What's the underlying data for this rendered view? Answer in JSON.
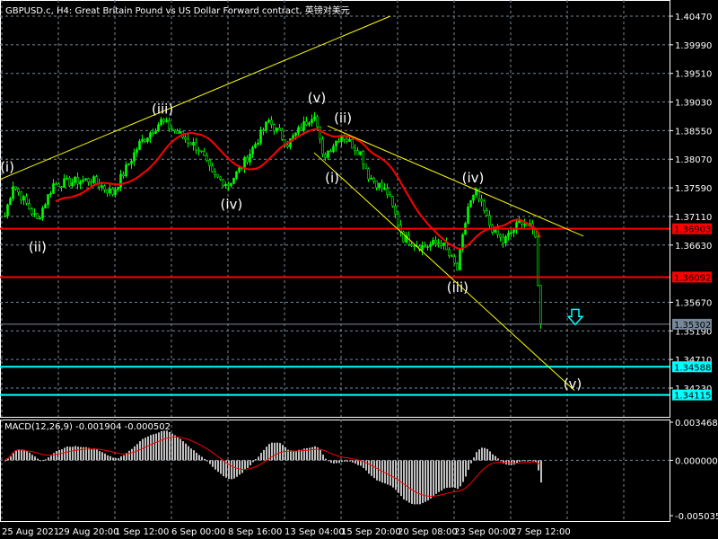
{
  "header": {
    "title": "GBPUSD.c, H4:  Great Britain Pound vs US Dollar Forward contract, 英镑对美元"
  },
  "macd": {
    "title": "MACD(12,26,9) -0.001904 -0.000502"
  },
  "colors": {
    "background": "#000000",
    "candle": "#00ff00",
    "grid": "#778899",
    "ma": "#ff0000",
    "trendline": "#ffff00",
    "support": "#00ffff",
    "resistance": "#ff0000",
    "current": "#778899",
    "macd_hist": "#c0c0c0",
    "macd_signal": "#ff0000"
  },
  "chart_data": {
    "type": "candlestick",
    "symbol": "GBPUSD.c",
    "timeframe": "H4",
    "ylim": [
      1.3395,
      1.4074
    ],
    "price_ticks": [
      "1.40470",
      "1.39990",
      "1.39510",
      "1.39030",
      "1.38550",
      "1.38070",
      "1.37590",
      "1.37110",
      "1.36630",
      "1.35670",
      "1.35190",
      "1.34710",
      "1.34230"
    ],
    "time_ticks": [
      "25 Aug 2021",
      "29 Aug 20:00",
      "1 Sep 12:00",
      "6 Sep 00:00",
      "8 Sep 16:00",
      "13 Sep 04:00",
      "15 Sep 20:00",
      "20 Sep 08:00",
      "23 Sep 00:00",
      "27 Sep 12:00"
    ],
    "bars_per_time_tick": 21,
    "close_waypoints": [
      [
        0,
        1.3712
      ],
      [
        3,
        1.3765
      ],
      [
        12,
        1.3705
      ],
      [
        18,
        1.3765
      ],
      [
        32,
        1.3773
      ],
      [
        40,
        1.375
      ],
      [
        50,
        1.3833
      ],
      [
        58,
        1.3871
      ],
      [
        72,
        1.3825
      ],
      [
        77,
        1.378
      ],
      [
        83,
        1.3765
      ],
      [
        88,
        1.3795
      ],
      [
        98,
        1.3871
      ],
      [
        105,
        1.3833
      ],
      [
        115,
        1.3886
      ],
      [
        118,
        1.381
      ],
      [
        125,
        1.3849
      ],
      [
        132,
        1.3818
      ],
      [
        135,
        1.378
      ],
      [
        142,
        1.375
      ],
      [
        148,
        1.3675
      ],
      [
        155,
        1.366
      ],
      [
        162,
        1.3668
      ],
      [
        168,
        1.3622
      ],
      [
        172,
        1.3727
      ],
      [
        175,
        1.375
      ],
      [
        180,
        1.3697
      ],
      [
        185,
        1.3668
      ],
      [
        192,
        1.3705
      ],
      [
        197,
        1.3682
      ],
      [
        198,
        1.3595
      ],
      [
        199,
        1.353
      ]
    ],
    "ma_period": 20,
    "horizontal_lines": [
      {
        "price": 1.36903,
        "label": "1.36903",
        "kind": "resistance"
      },
      {
        "price": 1.36092,
        "label": "1.36092",
        "kind": "resistance"
      },
      {
        "price": 1.34588,
        "label": "1.34588",
        "kind": "support"
      },
      {
        "price": 1.34115,
        "label": "1.34115",
        "kind": "support"
      }
    ],
    "current_price": {
      "price": 1.35302,
      "label": "1.35302"
    },
    "trendlines": [
      {
        "from": [
          -1.7,
          1.3773
        ],
        "to": [
          143.3,
          1.4047
        ]
      },
      {
        "from": [
          120,
          1.3863
        ],
        "to": [
          215,
          1.3678
        ]
      },
      {
        "from": [
          115,
          1.3818
        ],
        "to": [
          211.7,
          1.3419
        ]
      }
    ],
    "wave_labels": [
      {
        "text": "(i)",
        "bar": 1,
        "price": 1.3794
      },
      {
        "text": "(ii)",
        "bar": 12.3,
        "price": 1.366
      },
      {
        "text": "(iii)",
        "bar": 58.7,
        "price": 1.3891
      },
      {
        "text": "(iv)",
        "bar": 84.3,
        "price": 1.3731
      },
      {
        "text": "(v)",
        "bar": 116,
        "price": 1.391
      },
      {
        "text": "(i)",
        "bar": 121.7,
        "price": 1.3776
      },
      {
        "text": "(ii)",
        "bar": 125.7,
        "price": 1.3876
      },
      {
        "text": "(iii)",
        "bar": 168.3,
        "price": 1.3592
      },
      {
        "text": "(iv)",
        "bar": 174,
        "price": 1.3776
      },
      {
        "text": "(v)",
        "bar": 211,
        "price": 1.343
      }
    ],
    "arrow": {
      "direction": "down",
      "bar": 212,
      "price": 1.354
    },
    "macd": {
      "fast": 12,
      "slow": 26,
      "signal": 9,
      "value": -0.001904,
      "signal_value": -0.000502,
      "ylim": [
        -0.005035,
        0.003468
      ],
      "ticks": [
        "0.003468",
        "0.000000",
        "-0.005035"
      ]
    }
  }
}
